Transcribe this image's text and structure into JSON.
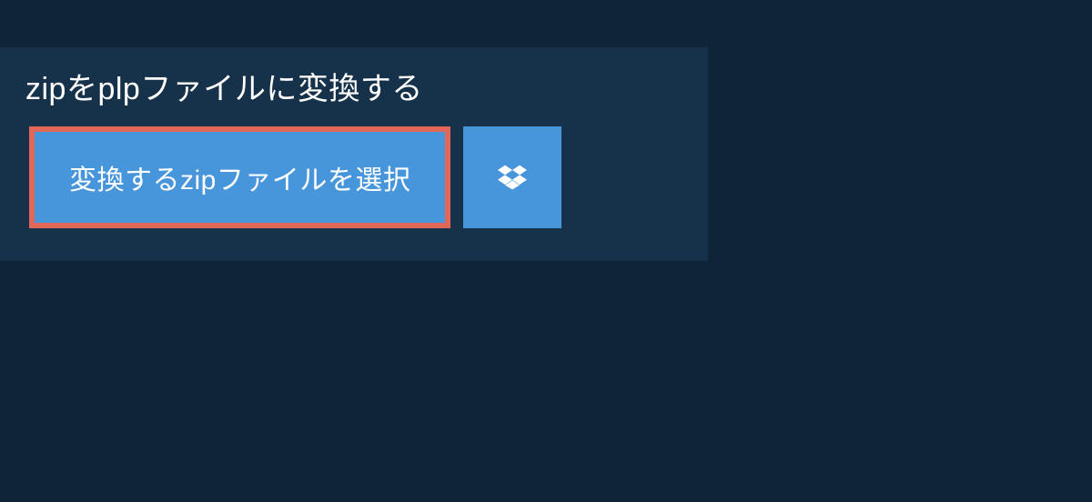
{
  "header": {
    "title": "zipをplpファイルに変換する"
  },
  "actions": {
    "select_file_label": "変換するzipファイルを選択"
  }
}
